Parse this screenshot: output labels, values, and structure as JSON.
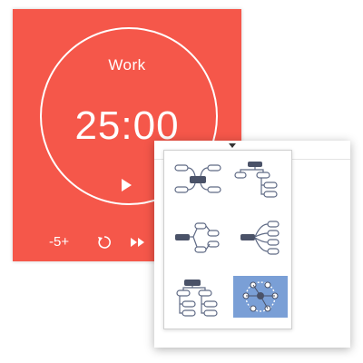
{
  "colors": {
    "accent": "#f5574a",
    "selected": "#7a9fd6",
    "node_dark": "#4a5268",
    "node_outline": "#5f6a85"
  },
  "timer": {
    "mode": "Work",
    "time": "25:00",
    "minus_label": "-5+",
    "play_icon": "play-icon",
    "reset_icon": "reset-icon",
    "skip_icon": "fast-forward-icon"
  },
  "layout_picker": {
    "options": [
      {
        "name": "mind-map-layout",
        "selected": false
      },
      {
        "name": "org-chart-right-layout",
        "selected": false
      },
      {
        "name": "logic-chart-layout",
        "selected": false
      },
      {
        "name": "fishbone-right-layout",
        "selected": false
      },
      {
        "name": "tree-chart-layout",
        "selected": false
      },
      {
        "name": "brace-map-layout",
        "selected": true
      }
    ]
  }
}
